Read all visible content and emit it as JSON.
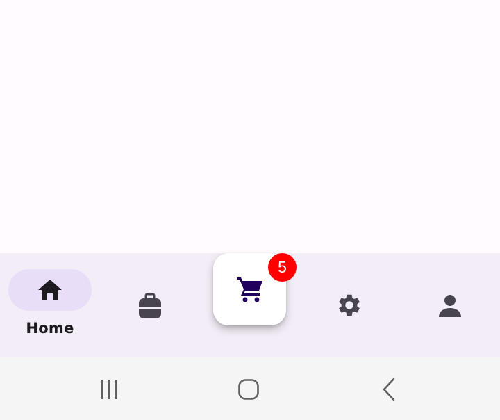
{
  "bottom_nav": {
    "selected": "Home",
    "items": [
      {
        "icon": "home-icon",
        "label": "Home"
      },
      {
        "icon": "briefcase-icon"
      },
      {
        "icon": "cart-icon",
        "badge": "5"
      },
      {
        "icon": "gear-icon"
      },
      {
        "icon": "person-icon"
      }
    ]
  },
  "system_nav": {
    "buttons": [
      "recents-icon",
      "home-circle-icon",
      "back-icon"
    ]
  },
  "colors": {
    "nav_background": "#f3edf7",
    "selected_pill": "#e8def8",
    "cart_icon": "#21005d",
    "badge": "#ff0000",
    "icon": "#49454f"
  }
}
